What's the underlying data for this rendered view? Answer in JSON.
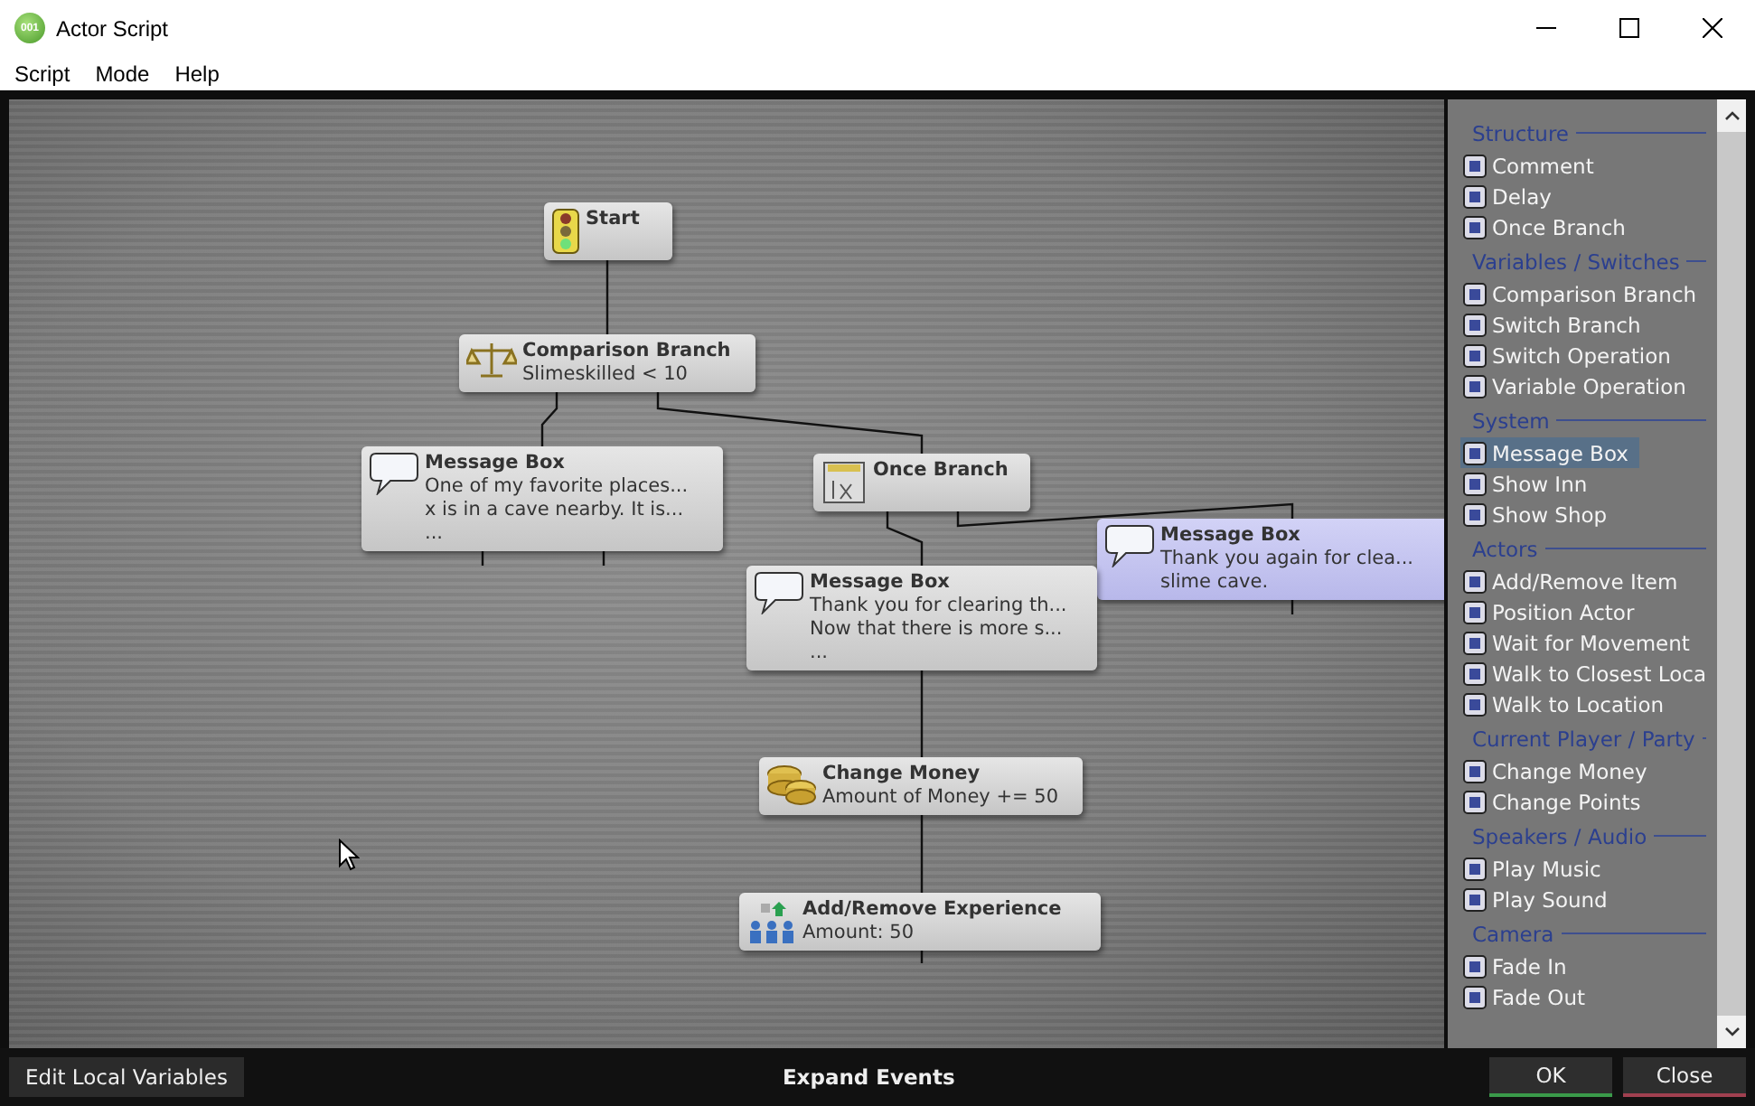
{
  "window": {
    "app_badge": "001",
    "title": "Actor Script"
  },
  "menu": [
    "Script",
    "Mode",
    "Help"
  ],
  "nodes": [
    {
      "kind": "start",
      "title": "Start",
      "selected": false
    },
    {
      "kind": "comparison_branch",
      "title": "Comparison Branch",
      "lines": [
        "Slimeskilled < 10"
      ],
      "selected": false
    },
    {
      "kind": "message_box",
      "title": "Message Box",
      "lines": [
        "One of my favorite places...",
        "x is in a cave nearby. It is...",
        "..."
      ],
      "selected": false
    },
    {
      "kind": "once_branch",
      "title": "Once Branch",
      "selected": false
    },
    {
      "kind": "message_box",
      "title": "Message Box",
      "lines": [
        "Thank you again for clea...",
        "slime cave."
      ],
      "selected": true
    },
    {
      "kind": "message_box",
      "title": "Message Box",
      "lines": [
        "Thank you for clearing th...",
        "Now that there is more s...",
        "..."
      ],
      "selected": false
    },
    {
      "kind": "change_money",
      "title": "Change Money",
      "lines": [
        "Amount of Money += 50"
      ],
      "selected": false
    },
    {
      "kind": "add_remove_experience",
      "title": "Add/Remove Experience",
      "lines": [
        "Amount: 50"
      ],
      "selected": false
    }
  ],
  "palette": [
    {
      "title": "Structure",
      "items": [
        {
          "label": "Comment",
          "selected": false
        },
        {
          "label": "Delay",
          "selected": false
        },
        {
          "label": "Once Branch",
          "selected": false
        }
      ]
    },
    {
      "title": "Variables / Switches",
      "items": [
        {
          "label": "Comparison Branch",
          "selected": false
        },
        {
          "label": "Switch Branch",
          "selected": false
        },
        {
          "label": "Switch Operation",
          "selected": false
        },
        {
          "label": "Variable Operation",
          "selected": false
        }
      ]
    },
    {
      "title": "System",
      "items": [
        {
          "label": "Message Box",
          "selected": true
        },
        {
          "label": "Show Inn",
          "selected": false
        },
        {
          "label": "Show Shop",
          "selected": false
        }
      ]
    },
    {
      "title": "Actors",
      "items": [
        {
          "label": "Add/Remove Item",
          "selected": false
        },
        {
          "label": "Position Actor",
          "selected": false
        },
        {
          "label": "Wait for Movement",
          "selected": false
        },
        {
          "label": "Walk to Closest Loca",
          "selected": false
        },
        {
          "label": "Walk to Location",
          "selected": false
        }
      ]
    },
    {
      "title": "Current Player / Party",
      "items": [
        {
          "label": "Change Money",
          "selected": false
        },
        {
          "label": "Change Points",
          "selected": false
        }
      ]
    },
    {
      "title": "Speakers / Audio",
      "items": [
        {
          "label": "Play Music",
          "selected": false
        },
        {
          "label": "Play Sound",
          "selected": false
        }
      ]
    },
    {
      "title": "Camera",
      "items": [
        {
          "label": "Fade In",
          "selected": false
        },
        {
          "label": "Fade Out",
          "selected": false
        }
      ]
    }
  ],
  "footer": {
    "left_button": "Edit Local Variables",
    "center_button": "Expand Events",
    "buttons": [
      "OK",
      "Close"
    ]
  }
}
